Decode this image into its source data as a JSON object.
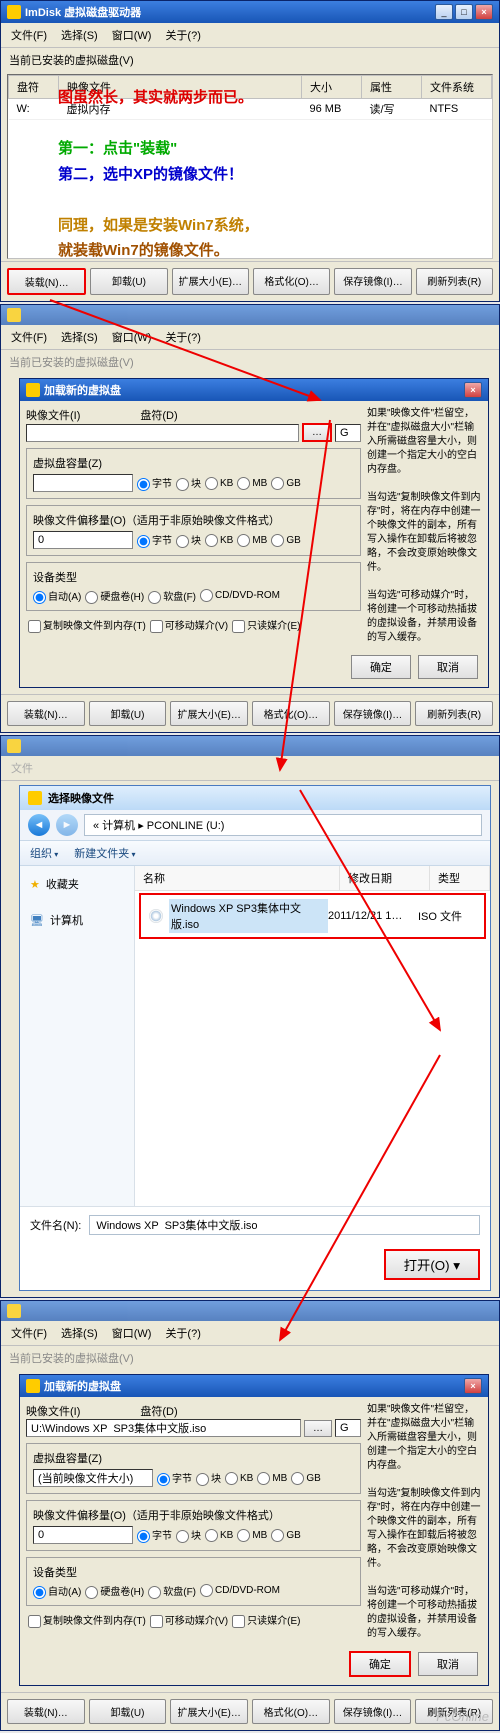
{
  "imdisk": {
    "title": "ImDisk 虚拟磁盘驱动器",
    "menu": [
      "文件(F)",
      "选择(S)",
      "窗口(W)",
      "关于(?)"
    ],
    "panel_label": "当前已安装的虚拟磁盘(V)",
    "columns": [
      "盘符",
      "映像文件",
      "大小",
      "属性",
      "文件系统"
    ],
    "row": {
      "drive": "W:",
      "image": "虚拟内存",
      "size": "96 MB",
      "attr": "读/写",
      "fs": "NTFS"
    },
    "buttons": [
      "装载(N)…",
      "卸载(U)",
      "扩展大小(E)…",
      "格式化(O)…",
      "保存镜像(I)…",
      "刷新列表(R)"
    ]
  },
  "overlay": {
    "line1": "图虽然长，其实就两步而已。",
    "line2": "第一：点击\"装载\"",
    "line3": "第二，选中XP的镜像文件！",
    "line4": "同理，如果是安装Win7系统，",
    "line5": "就装载Win7的镜像文件。"
  },
  "adddlg": {
    "title": "加载新的虚拟盘",
    "image_file_label": "映像文件(I)",
    "drive_label": "盘符(D)",
    "drive_value": "G",
    "capacity_label": "虚拟盘容量(Z)",
    "size_units": [
      "字节",
      "块",
      "KB",
      "MB",
      "GB"
    ],
    "offset_label": "映像文件偏移量(O)（适用于非原始映像文件格式）",
    "offset_value": "0",
    "device_type_label": "设备类型",
    "device_types": [
      "自动(A)",
      "硬盘卷(H)",
      "软盘(F)",
      "CD/DVD-ROM"
    ],
    "copy_to_mem": "复制映像文件到内存(T)",
    "removable": "可移动媒介(V)",
    "readonly": "只读媒介(E)",
    "ok": "确定",
    "cancel": "取消",
    "help1": "如果\"映像文件\"栏留空，并在\"虚拟磁盘大小\"栏输入所需磁盘容量大小，则创建一个指定大小的空白内存盘。",
    "help2": "当勾选\"复制映像文件到内存\"时，将在内存中创建一个映像文件的副本，所有写入操作在卸载后将被忽略，不会改变原始映像文件。",
    "help3": "当勾选\"可移动媒介\"时，将创建一个可移动热插拔的虚拟设备，并禁用设备的写入缓存。"
  },
  "filedlg": {
    "title": "选择映像文件",
    "breadcrumb": "« 计算机 ▸ PCONLINE (U:)",
    "toolbar": [
      "组织",
      "新建文件夹"
    ],
    "sidebar": {
      "favorites": "收藏夹",
      "computer": "计算机"
    },
    "columns": [
      "名称",
      "修改日期",
      "类型"
    ],
    "file": {
      "name": "Windows XP SP3集体中文版.iso",
      "date": "2011/12/21 1…",
      "type": "ISO 文件"
    },
    "filename_label": "文件名(N):",
    "filename_value": "Windows XP  SP3集体中文版.iso",
    "open": "打开(O)"
  },
  "adddlg2": {
    "image_value": "U:\\Windows XP  SP3集体中文版.iso",
    "capacity_value": "(当前映像文件大小)"
  },
  "watermark": "PcOnline"
}
